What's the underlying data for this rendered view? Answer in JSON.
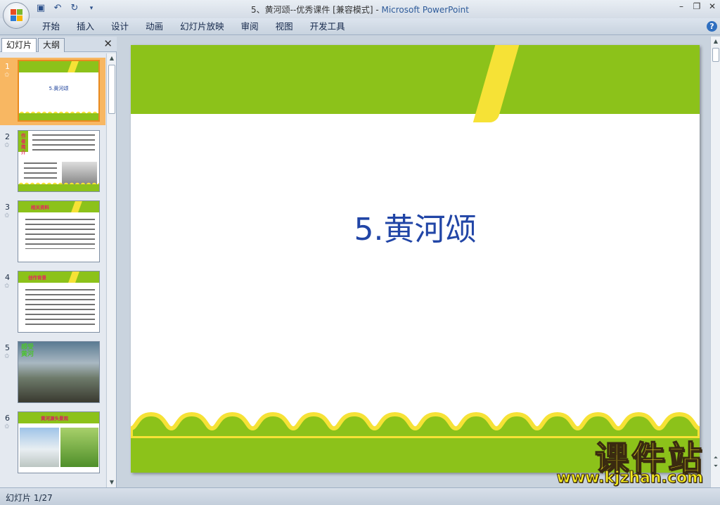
{
  "window": {
    "title": "5、黄河颂--优秀课件 [兼容模式] - ",
    "app_name": "Microsoft PowerPoint"
  },
  "qat": {
    "icons": [
      "save-icon",
      "undo-icon",
      "redo-icon",
      "customize-icon"
    ]
  },
  "ribbon": {
    "tabs": [
      "开始",
      "插入",
      "设计",
      "动画",
      "幻灯片放映",
      "审阅",
      "视图",
      "开发工具"
    ]
  },
  "left_pane": {
    "tab_slides": "幻灯片",
    "tab_outline": "大纲",
    "close_symbol": "✕",
    "slides": [
      {
        "num": "1",
        "title": "5.黄河颂"
      },
      {
        "num": "2",
        "heading": "作者简介"
      },
      {
        "num": "3",
        "heading": "相关资料"
      },
      {
        "num": "4",
        "heading": "创作背景"
      },
      {
        "num": "5",
        "heading": "感受黄河"
      },
      {
        "num": "6",
        "heading": "黄河源头景观"
      }
    ]
  },
  "slide": {
    "title": "5.黄河颂"
  },
  "status": {
    "text": "幻灯片 1/27"
  },
  "watermark": {
    "cn": "课件站",
    "url": "www.kjzhan.com"
  },
  "colors": {
    "green": "#8cc21a",
    "yellow": "#f6e236",
    "title_blue": "#2145a6"
  }
}
